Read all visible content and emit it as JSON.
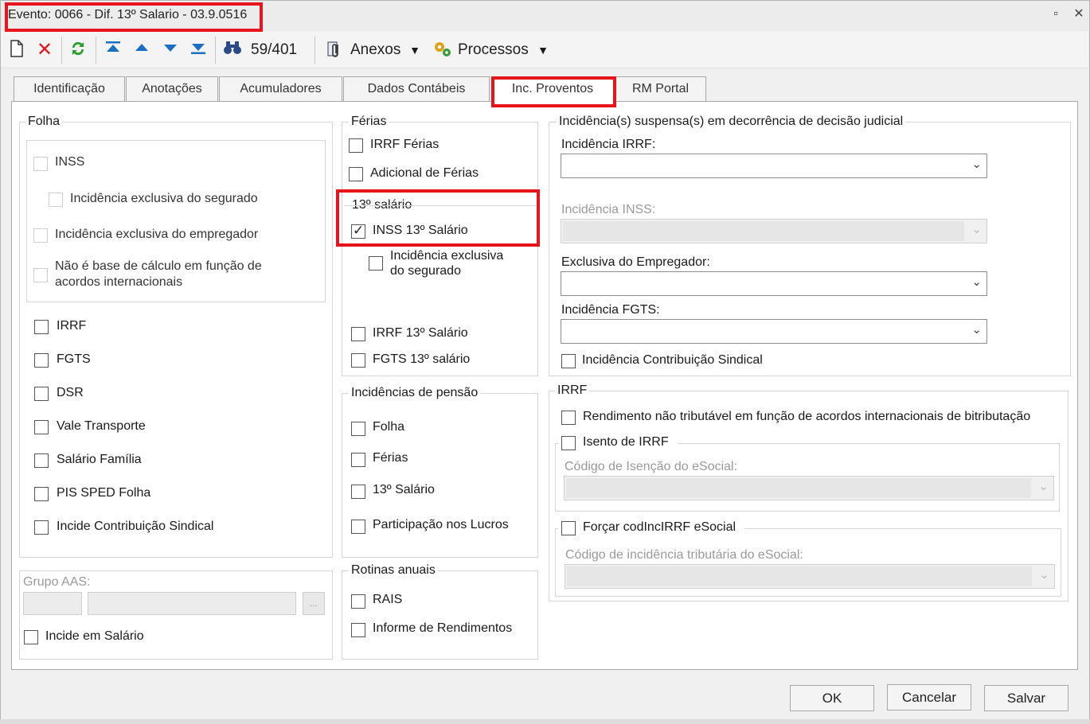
{
  "window": {
    "title": "Evento: 0066 - Dif. 13º Salario - 03.9.0516",
    "restore_glyph": "▫",
    "close_glyph": "✕"
  },
  "toolbar": {
    "record_counter": "59/401",
    "anexos_label": "Anexos",
    "processos_label": "Processos",
    "icons": {
      "new": "new-document-icon",
      "delete": "delete-icon",
      "refresh": "refresh-icon",
      "first": "first-record-icon",
      "previous": "previous-record-icon",
      "next": "next-record-icon",
      "last": "last-record-icon",
      "search": "binoculars-icon",
      "attach": "paperclip-icon",
      "process": "gears-icon"
    },
    "accent_colors": {
      "delete": "#e8141c",
      "refresh": "#2a9d2a",
      "nav": "#1b6fc2"
    }
  },
  "tabs": [
    "Identificação",
    "Anotações",
    "Acumuladores",
    "Dados Contábeis",
    "Inc. Proventos",
    "RM Portal"
  ],
  "active_tab": "Inc. Proventos",
  "folha": {
    "title": "Folha",
    "inss": {
      "label": "INSS",
      "checked": false,
      "enabled": false
    },
    "inc_segurado": {
      "label": "Incidência exclusiva do segurado",
      "checked": false,
      "enabled": false
    },
    "inc_empregador": {
      "label": "Incidência exclusiva do empregador",
      "checked": false,
      "enabled": false
    },
    "nao_base_1": "Não é base de cálculo em função de",
    "nao_base_2": "acordos internacionais",
    "irrf": "IRRF",
    "fgts": "FGTS",
    "dsr": "DSR",
    "vale_transporte": "Vale Transporte",
    "salario_familia": "Salário Família",
    "pis_sped": "PIS SPED Folha",
    "contrib_sindical": "Incide Contribuição Sindical"
  },
  "grupo_aas": {
    "label": "Grupo AAS:",
    "ellipsis": "...",
    "incide_salario": "Incide em Salário"
  },
  "ferias": {
    "title": "Férias",
    "irrf_ferias": "IRRF Férias",
    "adicional": "Adicional de Férias"
  },
  "decimo": {
    "title": "13º salário",
    "inss": {
      "label": "INSS 13º Salário",
      "checked": true
    },
    "inc_excl_1": "Incidência exclusiva",
    "inc_excl_2": "do segurado",
    "irrf": "IRRF 13º Salário",
    "fgts": "FGTS 13º salário"
  },
  "pensao": {
    "title": "Incidências de pensão",
    "folha": "Folha",
    "ferias": "Férias",
    "decimo": "13º Salário",
    "lucros": "Participação nos Lucros"
  },
  "rotinas": {
    "title": "Rotinas anuais",
    "rais": "RAIS",
    "informe": "Informe de Rendimentos"
  },
  "suspensa": {
    "title": "Incidência(s) suspensa(s) em decorrência de decisão judicial",
    "irrf_label": "Incidência IRRF:",
    "inss_label": "Incidência INSS:",
    "empregador_label": "Exclusiva do Empregador:",
    "fgts_label": "Incidência FGTS:",
    "contrib": "Incidência Contribuição Sindical"
  },
  "irrf_group": {
    "title": "IRRF",
    "rendimento": "Rendimento não tributável em função de acordos internacionais de bitributação",
    "isento": "Isento de IRRF",
    "cod_isencao": "Código de Isenção do eSocial:",
    "forcar": "Forçar codIncIRRF eSocial",
    "cod_incidencia": "Código de incidência tributária do eSocial:"
  },
  "buttons": {
    "ok": "OK",
    "cancelar": "Cancelar",
    "salvar": "Salvar"
  },
  "highlight_color": "#e8141c",
  "chevron": "⌄",
  "check_glyph": "✓"
}
